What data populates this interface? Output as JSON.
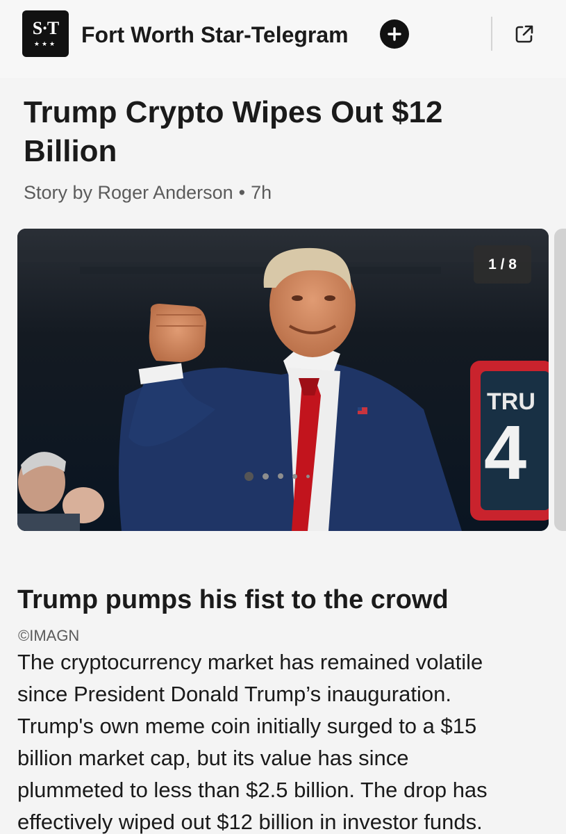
{
  "header": {
    "logo_text": "S·T",
    "logo_stars": "★★★",
    "publisher": "Fort Worth Star-Telegram",
    "follow_icon": "plus-icon",
    "share_icon": "external-link-icon"
  },
  "article": {
    "title": "Trump Crypto Wipes Out $12 Billion",
    "byline": "Story by Roger Anderson",
    "age": "7h",
    "gallery": {
      "counter": "1 / 8",
      "current": 1,
      "total": 8
    },
    "caption": "Trump pumps his fist to the crowd",
    "credit": "©IMAGN",
    "body_lines": [
      "The cryptocurrency market has remained volatile",
      "since President Donald Trump’s inauguration.",
      "Trump's own meme coin initially surged to a $15",
      "billion market cap, but its value has since",
      "plummeted to less than $2.5 billion. The drop has",
      "effectively wiped out $12 billion in investor funds."
    ]
  },
  "colors": {
    "background": "#f4f4f4",
    "text": "#1a1a1a",
    "muted": "#5b5b5b",
    "suit": "#1f3566",
    "tie": "#b3141c"
  }
}
